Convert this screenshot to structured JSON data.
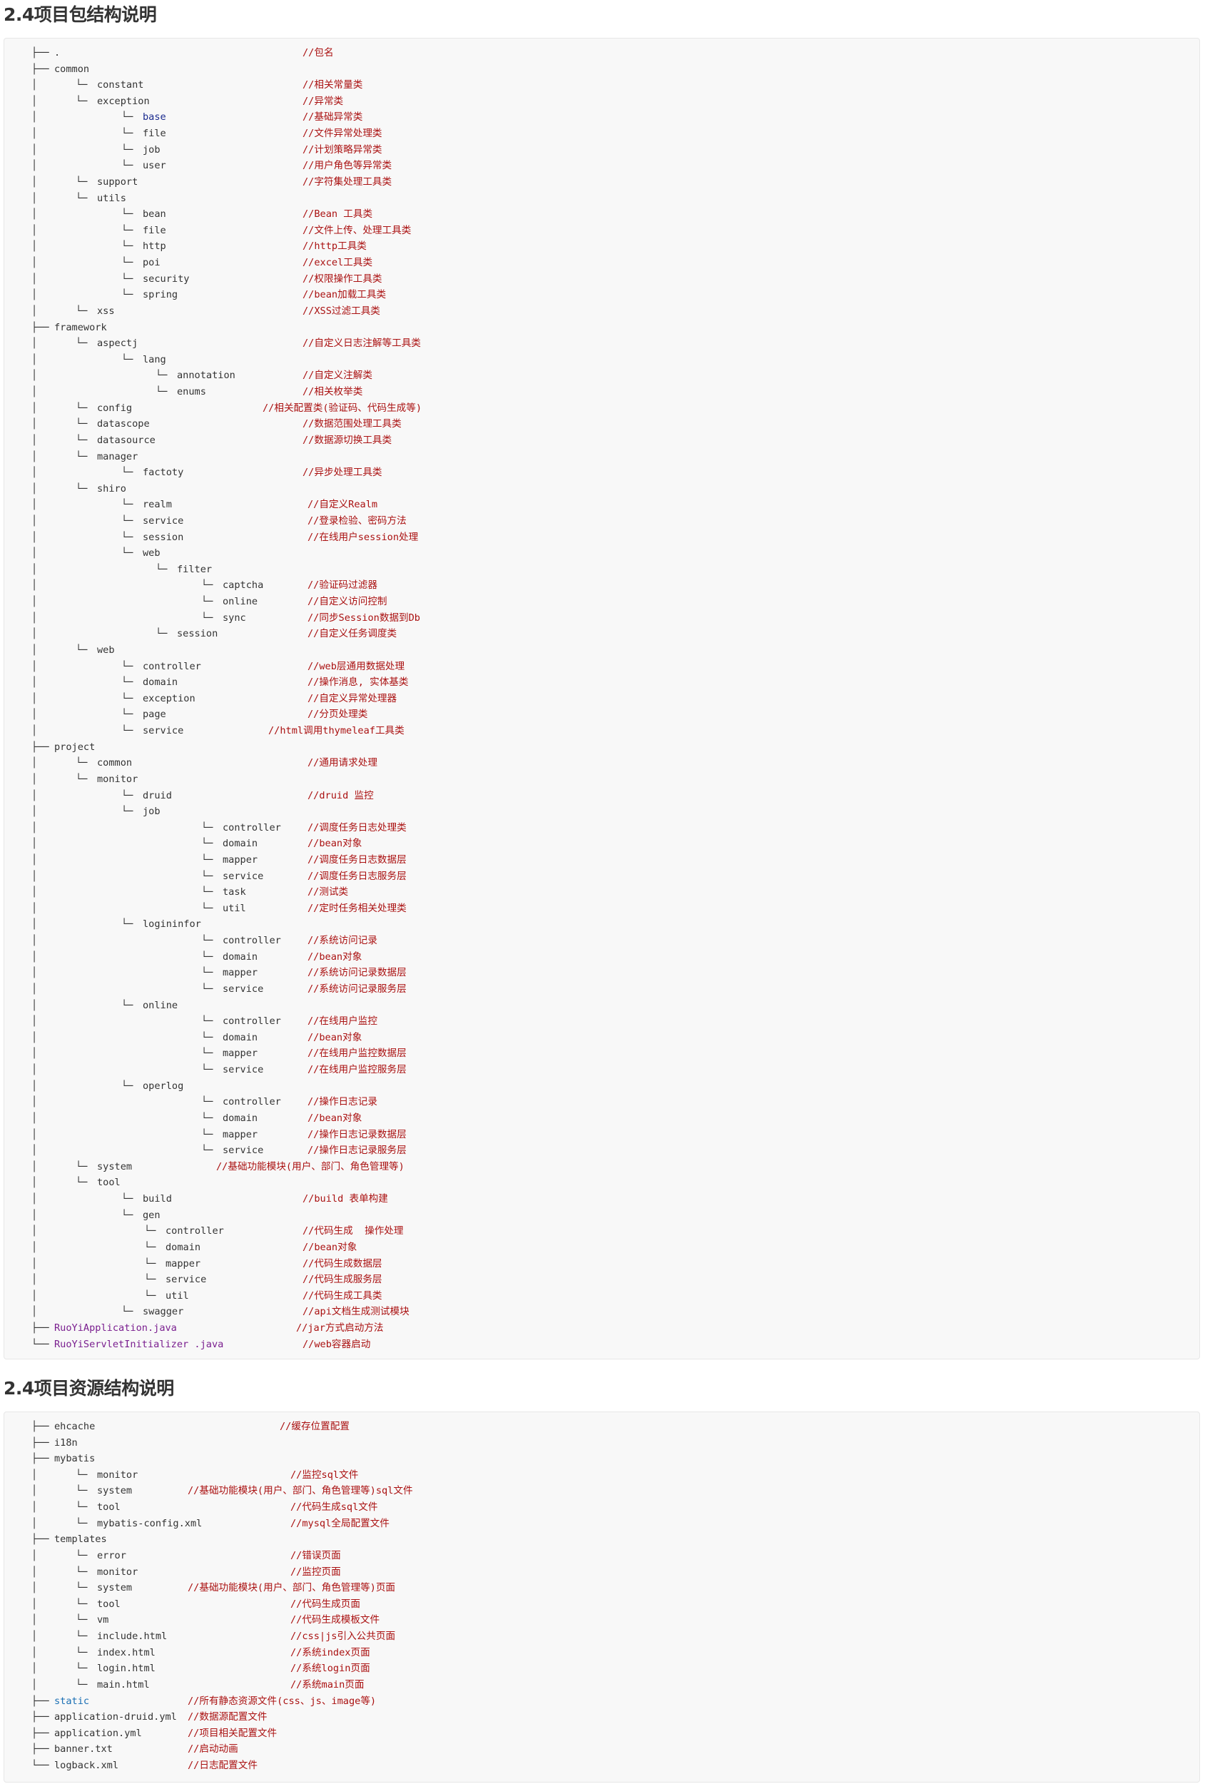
{
  "package_section": {
    "heading": "2.4项目包结构说明",
    "lines": [
      {
        "tree": "├──",
        "name": ".",
        "comment": "//包名",
        "depth": 0,
        "style": "plain"
      },
      {
        "tree": "├──",
        "name": "common",
        "comment": "",
        "depth": 0,
        "style": "plain"
      },
      {
        "tree": "│       └──",
        "name": "constant",
        "comment": "//相关常量类",
        "depth": 1,
        "style": "plain"
      },
      {
        "tree": "│       └──",
        "name": "exception",
        "comment": "//异常类",
        "depth": 1,
        "style": "plain"
      },
      {
        "tree": "│               └──",
        "name": "base",
        "comment": "//基础异常类",
        "depth": 2,
        "style": "kw"
      },
      {
        "tree": "│               └──",
        "name": "file",
        "comment": "//文件异常处理类",
        "depth": 2,
        "style": "plain"
      },
      {
        "tree": "│               └──",
        "name": "job",
        "comment": "//计划策略异常类",
        "depth": 2,
        "style": "plain"
      },
      {
        "tree": "│               └──",
        "name": "user",
        "comment": "//用户角色等异常类",
        "depth": 2,
        "style": "plain"
      },
      {
        "tree": "│       └──",
        "name": "support",
        "comment": "//字符集处理工具类",
        "depth": 1,
        "style": "plain"
      },
      {
        "tree": "│       └──",
        "name": "utils",
        "comment": "",
        "depth": 1,
        "style": "plain"
      },
      {
        "tree": "│               └──",
        "name": "bean",
        "comment": "//Bean 工具类",
        "depth": 2,
        "style": "plain"
      },
      {
        "tree": "│               └──",
        "name": "file",
        "comment": "//文件上传、处理工具类",
        "depth": 2,
        "style": "plain"
      },
      {
        "tree": "│               └──",
        "name": "http",
        "comment": "//http工具类",
        "depth": 2,
        "style": "plain"
      },
      {
        "tree": "│               └──",
        "name": "poi",
        "comment": "//excel工具类",
        "depth": 2,
        "style": "plain"
      },
      {
        "tree": "│               └──",
        "name": "security",
        "comment": "//权限操作工具类",
        "depth": 2,
        "style": "plain"
      },
      {
        "tree": "│               └──",
        "name": "spring",
        "comment": "//bean加载工具类",
        "depth": 2,
        "style": "plain"
      },
      {
        "tree": "│       └──",
        "name": "xss",
        "comment": "//XSS过滤工具类",
        "depth": 1,
        "style": "plain"
      },
      {
        "tree": "├──",
        "name": "framework",
        "comment": "",
        "depth": 0,
        "style": "plain"
      },
      {
        "tree": "│       └──",
        "name": "aspectj",
        "comment": "//自定义日志注解等工具类",
        "depth": 1,
        "style": "plain"
      },
      {
        "tree": "│               └──",
        "name": "lang",
        "comment": "",
        "depth": 2,
        "style": "plain"
      },
      {
        "tree": "│                     └──",
        "name": "annotation",
        "comment": "//自定义注解类",
        "depth": 3,
        "style": "plain"
      },
      {
        "tree": "│                     └──",
        "name": "enums",
        "comment": "//相关枚举类",
        "depth": 3,
        "style": "plain"
      },
      {
        "tree": "│       └──",
        "name": "config",
        "comment": "//相关配置类(验证码、代码生成等)",
        "depth": 1,
        "style": "plain",
        "comment_pos": "early"
      },
      {
        "tree": "│       └──",
        "name": "datascope",
        "comment": "//数据范围处理工具类",
        "depth": 1,
        "style": "plain"
      },
      {
        "tree": "│       └──",
        "name": "datasource",
        "comment": "//数据源切换工具类",
        "depth": 1,
        "style": "plain"
      },
      {
        "tree": "│       └──",
        "name": "manager",
        "comment": "",
        "depth": 1,
        "style": "plain"
      },
      {
        "tree": "│               └──",
        "name": "factoty",
        "comment": "//异步处理工具类",
        "depth": 2,
        "style": "plain"
      },
      {
        "tree": "│       └──",
        "name": "shiro",
        "comment": "",
        "depth": 1,
        "style": "plain"
      },
      {
        "tree": "│               └──",
        "name": "realm",
        "comment": "//自定义Realm",
        "depth": 2,
        "style": "plain",
        "comment_pos": "late"
      },
      {
        "tree": "│               └──",
        "name": "service",
        "comment": "//登录检验、密码方法",
        "depth": 2,
        "style": "plain",
        "comment_pos": "late"
      },
      {
        "tree": "│               └──",
        "name": "session",
        "comment": "//在线用户session处理",
        "depth": 2,
        "style": "plain",
        "comment_pos": "late"
      },
      {
        "tree": "│               └──",
        "name": "web",
        "comment": "",
        "depth": 2,
        "style": "plain"
      },
      {
        "tree": "│                     └──",
        "name": "filter",
        "comment": "",
        "depth": 3,
        "style": "plain"
      },
      {
        "tree": "│                             └──",
        "name": "captcha",
        "comment": "//验证码过滤器",
        "depth": 4,
        "style": "plain",
        "comment_pos": "late"
      },
      {
        "tree": "│                             └──",
        "name": "online",
        "comment": "//自定义访问控制",
        "depth": 4,
        "style": "plain",
        "comment_pos": "late"
      },
      {
        "tree": "│                             └──",
        "name": "sync",
        "comment": "//同步Session数据到Db",
        "depth": 4,
        "style": "plain",
        "comment_pos": "late"
      },
      {
        "tree": "│                     └──",
        "name": "session",
        "comment": "//自定义任务调度类",
        "depth": 3,
        "style": "plain",
        "comment_pos": "late"
      },
      {
        "tree": "│       └──",
        "name": "web",
        "comment": "",
        "depth": 1,
        "style": "plain"
      },
      {
        "tree": "│               └──",
        "name": "controller",
        "comment": "//web层通用数据处理",
        "depth": 2,
        "style": "plain",
        "comment_pos": "late"
      },
      {
        "tree": "│               └──",
        "name": "domain",
        "comment": "//操作消息, 实体基类",
        "depth": 2,
        "style": "plain",
        "comment_pos": "late"
      },
      {
        "tree": "│               └──",
        "name": "exception",
        "comment": "//自定义异常处理器",
        "depth": 2,
        "style": "plain",
        "comment_pos": "late"
      },
      {
        "tree": "│               └──",
        "name": "page",
        "comment": "//分页处理类",
        "depth": 2,
        "style": "plain",
        "comment_pos": "late"
      },
      {
        "tree": "│               └──",
        "name": "service",
        "comment": "//html调用thymeleaf工具类",
        "depth": 2,
        "style": "plain",
        "comment_pos": "mid"
      },
      {
        "tree": "├──",
        "name": "project",
        "comment": "",
        "depth": 0,
        "style": "plain"
      },
      {
        "tree": "│       └──",
        "name": "common",
        "comment": "//通用请求处理",
        "depth": 1,
        "style": "plain",
        "comment_pos": "late"
      },
      {
        "tree": "│       └──",
        "name": "monitor",
        "comment": "",
        "depth": 1,
        "style": "plain"
      },
      {
        "tree": "│               └──",
        "name": "druid",
        "comment": "//druid 监控",
        "depth": 2,
        "style": "plain",
        "comment_pos": "late"
      },
      {
        "tree": "│               └──",
        "name": "job",
        "comment": "",
        "depth": 2,
        "style": "plain"
      },
      {
        "tree": "│                             └──",
        "name": "controller",
        "comment": "//调度任务日志处理类",
        "depth": 4,
        "style": "plain",
        "comment_pos": "late"
      },
      {
        "tree": "│                             └──",
        "name": "domain",
        "comment": "//bean对象",
        "depth": 4,
        "style": "plain",
        "comment_pos": "late"
      },
      {
        "tree": "│                             └──",
        "name": "mapper",
        "comment": "//调度任务日志数据层",
        "depth": 4,
        "style": "plain",
        "comment_pos": "late"
      },
      {
        "tree": "│                             └──",
        "name": "service",
        "comment": "//调度任务日志服务层",
        "depth": 4,
        "style": "plain",
        "comment_pos": "late"
      },
      {
        "tree": "│                             └──",
        "name": "task",
        "comment": "//测试类",
        "depth": 4,
        "style": "plain",
        "comment_pos": "late"
      },
      {
        "tree": "│                             └──",
        "name": "util",
        "comment": "//定时任务相关处理类",
        "depth": 4,
        "style": "plain",
        "comment_pos": "late"
      },
      {
        "tree": "│               └──",
        "name": "logininfor",
        "comment": "",
        "depth": 2,
        "style": "plain"
      },
      {
        "tree": "│                             └──",
        "name": "controller",
        "comment": "//系统访问记录",
        "depth": 4,
        "style": "plain",
        "comment_pos": "late"
      },
      {
        "tree": "│                             └──",
        "name": "domain",
        "comment": "//bean对象",
        "depth": 4,
        "style": "plain",
        "comment_pos": "late"
      },
      {
        "tree": "│                             └──",
        "name": "mapper",
        "comment": "//系统访问记录数据层",
        "depth": 4,
        "style": "plain",
        "comment_pos": "late"
      },
      {
        "tree": "│                             └──",
        "name": "service",
        "comment": "//系统访问记录服务层",
        "depth": 4,
        "style": "plain",
        "comment_pos": "late"
      },
      {
        "tree": "│               └──",
        "name": "online",
        "comment": "",
        "depth": 2,
        "style": "plain"
      },
      {
        "tree": "│                             └──",
        "name": "controller",
        "comment": "//在线用户监控",
        "depth": 4,
        "style": "plain",
        "comment_pos": "late"
      },
      {
        "tree": "│                             └──",
        "name": "domain",
        "comment": "//bean对象",
        "depth": 4,
        "style": "plain",
        "comment_pos": "late"
      },
      {
        "tree": "│                             └──",
        "name": "mapper",
        "comment": "//在线用户监控数据层",
        "depth": 4,
        "style": "plain",
        "comment_pos": "late"
      },
      {
        "tree": "│                             └──",
        "name": "service",
        "comment": "//在线用户监控服务层",
        "depth": 4,
        "style": "plain",
        "comment_pos": "late"
      },
      {
        "tree": "│               └──",
        "name": "operlog",
        "comment": "",
        "depth": 2,
        "style": "plain"
      },
      {
        "tree": "│                             └──",
        "name": "controller",
        "comment": "//操作日志记录",
        "depth": 4,
        "style": "plain",
        "comment_pos": "late"
      },
      {
        "tree": "│                             └──",
        "name": "domain",
        "comment": "//bean对象",
        "depth": 4,
        "style": "plain",
        "comment_pos": "late"
      },
      {
        "tree": "│                             └──",
        "name": "mapper",
        "comment": "//操作日志记录数据层",
        "depth": 4,
        "style": "plain",
        "comment_pos": "late"
      },
      {
        "tree": "│                             └──",
        "name": "service",
        "comment": "//操作日志记录服务层",
        "depth": 4,
        "style": "plain",
        "comment_pos": "late"
      },
      {
        "tree": "│       └──",
        "name": "system",
        "comment": "//基础功能模块(用户、部门、角色管理等)",
        "depth": 1,
        "style": "plain",
        "comment_pos": "sys"
      },
      {
        "tree": "│       └──",
        "name": "tool",
        "comment": "",
        "depth": 1,
        "style": "plain"
      },
      {
        "tree": "│               └──",
        "name": "build",
        "comment": "//build 表单构建",
        "depth": 2,
        "style": "plain"
      },
      {
        "tree": "│               └──",
        "name": "gen",
        "comment": "",
        "depth": 2,
        "style": "plain"
      },
      {
        "tree": "│                   └──",
        "name": "controller",
        "comment": "//代码生成  操作处理",
        "depth": 3,
        "style": "plain",
        "name_pos": "gen"
      },
      {
        "tree": "│                   └──",
        "name": "domain",
        "comment": "//bean对象",
        "depth": 3,
        "style": "plain",
        "name_pos": "gen"
      },
      {
        "tree": "│                   └──",
        "name": "mapper",
        "comment": "//代码生成数据层",
        "depth": 3,
        "style": "plain",
        "name_pos": "gen"
      },
      {
        "tree": "│                   └──",
        "name": "service",
        "comment": "//代码生成服务层",
        "depth": 3,
        "style": "plain",
        "name_pos": "gen"
      },
      {
        "tree": "│                   └──",
        "name": "util",
        "comment": "//代码生成工具类",
        "depth": 3,
        "style": "plain",
        "name_pos": "gen"
      },
      {
        "tree": "│               └──",
        "name": "swagger",
        "comment": "//api文档生成测试模块",
        "depth": 2,
        "style": "plain"
      },
      {
        "tree": "├──",
        "name": "RuoYiApplication.java",
        "comment": "//jar方式启动方法",
        "depth": 0,
        "style": "cls",
        "comment_pos": "jar"
      },
      {
        "tree": "└──",
        "name": "RuoYiServletInitializer .java",
        "comment": "//web容器启动",
        "depth": 0,
        "style": "cls"
      }
    ]
  },
  "resource_section": {
    "heading": "2.4项目资源结构说明",
    "lines": [
      {
        "tree": "├──",
        "name": "ehcache",
        "comment": "//缓存位置配置",
        "depth": 0,
        "style": "plain",
        "comment_pos": "r0"
      },
      {
        "tree": "├──",
        "name": "i18n",
        "comment": "",
        "depth": 0,
        "style": "plain"
      },
      {
        "tree": "├──",
        "name": "mybatis",
        "comment": "",
        "depth": 0,
        "style": "plain"
      },
      {
        "tree": "│       └──",
        "name": "monitor",
        "comment": "//监控sql文件",
        "depth": 1,
        "style": "plain",
        "comment_pos": "r1"
      },
      {
        "tree": "│       └──",
        "name": "system",
        "comment": "//基础功能模块(用户、部门、角色管理等)sql文件",
        "depth": 1,
        "style": "plain",
        "comment_pos": "r2"
      },
      {
        "tree": "│       └──",
        "name": "tool",
        "comment": "//代码生成sql文件",
        "depth": 1,
        "style": "plain",
        "comment_pos": "r1"
      },
      {
        "tree": "│       └──",
        "name": "mybatis-config.xml",
        "comment": "//mysql全局配置文件",
        "depth": 1,
        "style": "plain",
        "comment_pos": "r1"
      },
      {
        "tree": "├──",
        "name": "templates",
        "comment": "",
        "depth": 0,
        "style": "plain"
      },
      {
        "tree": "│       └──",
        "name": "error",
        "comment": "//错误页面",
        "depth": 1,
        "style": "plain",
        "comment_pos": "r1"
      },
      {
        "tree": "│       └──",
        "name": "monitor",
        "comment": "//监控页面",
        "depth": 1,
        "style": "plain",
        "comment_pos": "r1"
      },
      {
        "tree": "│       └──",
        "name": "system",
        "comment": "//基础功能模块(用户、部门、角色管理等)页面",
        "depth": 1,
        "style": "plain",
        "comment_pos": "r2"
      },
      {
        "tree": "│       └──",
        "name": "tool",
        "comment": "//代码生成页面",
        "depth": 1,
        "style": "plain",
        "comment_pos": "r1"
      },
      {
        "tree": "│       └──",
        "name": "vm",
        "comment": "//代码生成模板文件",
        "depth": 1,
        "style": "plain",
        "comment_pos": "r1"
      },
      {
        "tree": "│       └──",
        "name": "include.html",
        "comment": "//css|js引入公共页面",
        "depth": 1,
        "style": "plain",
        "comment_pos": "r1"
      },
      {
        "tree": "│       └──",
        "name": "index.html",
        "comment": "//系统index页面",
        "depth": 1,
        "style": "plain",
        "comment_pos": "r1"
      },
      {
        "tree": "│       └──",
        "name": "login.html",
        "comment": "//系统login页面",
        "depth": 1,
        "style": "plain",
        "comment_pos": "r1"
      },
      {
        "tree": "│       └──",
        "name": "main.html",
        "comment": "//系统main页面",
        "depth": 1,
        "style": "plain",
        "comment_pos": "r1"
      },
      {
        "tree": "├──",
        "name": "static",
        "comment": "//所有静态资源文件(css、js、image等)",
        "depth": 0,
        "style": "pkg",
        "comment_pos": "r2"
      },
      {
        "tree": "├──",
        "name": "application-druid.yml",
        "comment": "//数据源配置文件",
        "depth": 0,
        "style": "plain",
        "comment_pos": "r2"
      },
      {
        "tree": "├──",
        "name": "application.yml",
        "comment": "//项目相关配置文件",
        "depth": 0,
        "style": "plain",
        "comment_pos": "r2"
      },
      {
        "tree": "├──",
        "name": "banner.txt",
        "comment": "//启动动画",
        "depth": 0,
        "style": "plain",
        "comment_pos": "r2"
      },
      {
        "tree": "└──",
        "name": "logback.xml",
        "comment": "//日志配置文件",
        "depth": 0,
        "style": "plain",
        "comment_pos": "r2"
      }
    ]
  }
}
